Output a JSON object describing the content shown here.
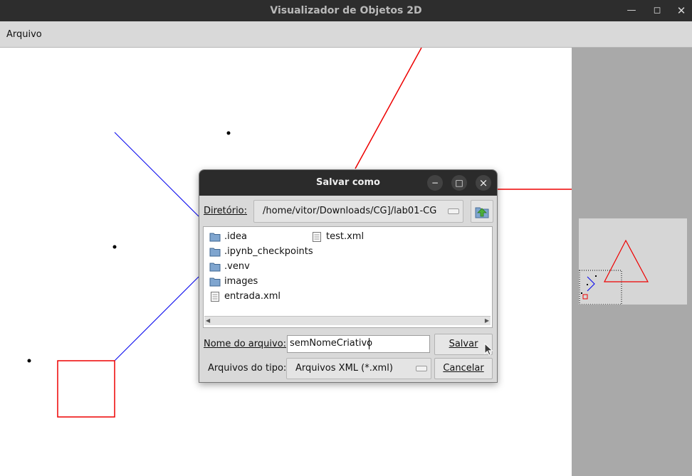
{
  "window": {
    "title": "Visualizador de Objetos 2D",
    "controls": [
      "minimize-icon",
      "maximize-icon",
      "close-icon"
    ]
  },
  "menu": {
    "items": [
      "Arquivo"
    ]
  },
  "canvas": {
    "colors": {
      "line": "#0000ff",
      "shape": "#ee0000",
      "point": "#000000"
    },
    "objects": [
      "red-line",
      "blue-line",
      "red-square",
      "points"
    ]
  },
  "dialog": {
    "title": "Salvar como",
    "title_buttons": {
      "minimize": "−",
      "maximize": "□",
      "close": "×"
    },
    "directory_label": "Diretório:",
    "directory_value": "/home/vitor/Downloads/CG]/lab01-CG",
    "files": [
      {
        "name": ".idea",
        "type": "folder"
      },
      {
        "name": ".ipynb_checkpoints",
        "type": "folder"
      },
      {
        "name": ".venv",
        "type": "folder"
      },
      {
        "name": "images",
        "type": "folder"
      },
      {
        "name": "entrada.xml",
        "type": "file"
      },
      {
        "name": "test.xml",
        "type": "file"
      }
    ],
    "filename_label": "Nome do arquivo:",
    "filename_value": "semNomeCriativo",
    "filetype_label": "Arquivos do tipo:",
    "filetype_value": "Arquivos XML (*.xml)",
    "save_label": "Salvar",
    "cancel_label": "Cancelar"
  }
}
